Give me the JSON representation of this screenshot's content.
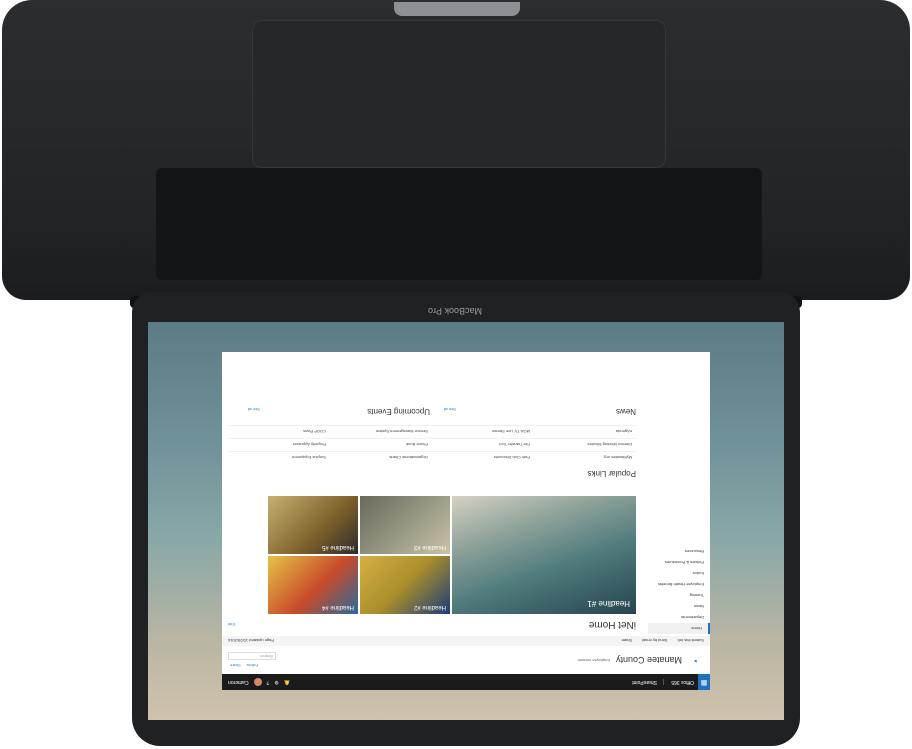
{
  "device": {
    "brand": "MacBook Pro"
  },
  "suite_bar": {
    "app_launcher_icon": "waffle-icon",
    "title": "Office 365",
    "app": "SharePoint",
    "user_name": "Cameron"
  },
  "site": {
    "title": "Manatee County",
    "subtitle": "Employee Intranet",
    "actions": [
      "Follow",
      "Share"
    ],
    "search_placeholder": "Search"
  },
  "command_bar": {
    "left": [
      "Submit this InIt",
      "Send by email",
      "Share"
    ],
    "right": "Page updated 10/25/2016"
  },
  "left_nav": [
    "Home",
    "Departments",
    "News",
    "Training",
    "Employee Health Benefits",
    "Kudos",
    "Policies & Procedures",
    "Resources"
  ],
  "main": {
    "page_title": "iNet Home",
    "edit_label": "Edit",
    "hero": {
      "headline": "Headline #1"
    },
    "tiles": [
      {
        "headline": "Headline #2"
      },
      {
        "headline": "Headline #3"
      },
      {
        "headline": "Headline #4"
      },
      {
        "headline": "Headline #5"
      }
    ],
    "popular_links": {
      "title": "Popular Links",
      "rows": [
        [
          "MyManatee.org",
          "Park Club Discounts",
          "Organizational Charts",
          "Surplus Equipment"
        ],
        [
          "Director Meeting Minutes",
          "File Transfer Tool",
          "Phone Book",
          "Property Appraiser"
        ],
        [
          "eAgenda",
          "MGA-TV Live Stream",
          "Service Management System",
          "COOP Plans"
        ]
      ]
    },
    "news": {
      "title": "News",
      "see_all": "See all"
    },
    "events": {
      "title": "Upcoming Events",
      "see_all": "See all"
    }
  }
}
